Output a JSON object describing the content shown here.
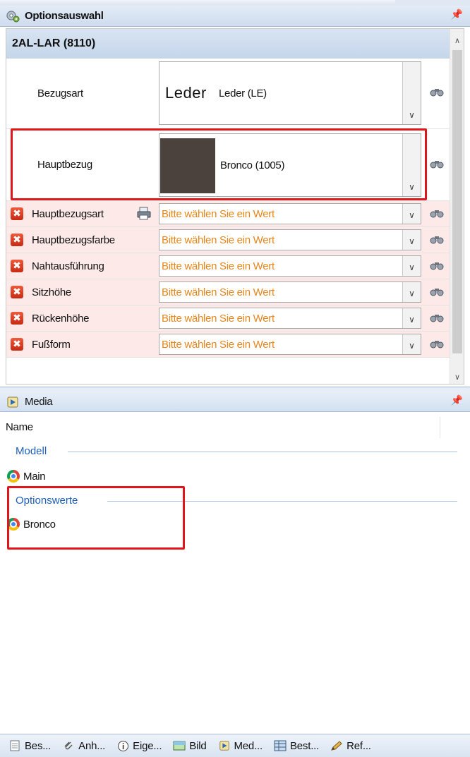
{
  "options_pane": {
    "title": "Optionsauswahl",
    "group_title": "2AL-LAR (8110)",
    "rows": [
      {
        "label": "Bezugsart",
        "prefix": "Leder",
        "value": "Leder (LE)"
      },
      {
        "label": "Hauptbezug",
        "value": "Bronco (1005)",
        "swatch_color": "#4b423d"
      },
      {
        "label": "Hauptbezugsart",
        "value": "Bitte wählen Sie ein Wert"
      },
      {
        "label": "Hauptbezugsfarbe",
        "value": "Bitte wählen Sie ein Wert"
      },
      {
        "label": "Nahtausführung",
        "value": "Bitte wählen Sie ein Wert"
      },
      {
        "label": "Sitzhöhe",
        "value": "Bitte wählen Sie ein Wert"
      },
      {
        "label": "Rückenhöhe",
        "value": "Bitte wählen Sie ein Wert"
      },
      {
        "label": "Fußform",
        "value": "Bitte wählen Sie ein Wert"
      }
    ]
  },
  "media_pane": {
    "title": "Media",
    "column_header": "Name",
    "groups": [
      {
        "label": "Modell",
        "items": [
          "Main"
        ]
      },
      {
        "label": "Optionswerte",
        "items": [
          "Bronco"
        ]
      }
    ]
  },
  "tabs": [
    {
      "label": "Bes...",
      "icon": "document-icon"
    },
    {
      "label": "Anh...",
      "icon": "paperclip-icon"
    },
    {
      "label": "Eige...",
      "icon": "info-icon"
    },
    {
      "label": "Bild",
      "icon": "image-icon"
    },
    {
      "label": "Med...",
      "icon": "media-icon"
    },
    {
      "label": "Best...",
      "icon": "grid-icon"
    },
    {
      "label": "Ref...",
      "icon": "pencil-icon"
    }
  ],
  "colors": {
    "error_row_bg": "#fde9e7",
    "placeholder_text": "#e8861a",
    "highlight_border": "#e0171a",
    "group_link": "#1f5fb8"
  }
}
